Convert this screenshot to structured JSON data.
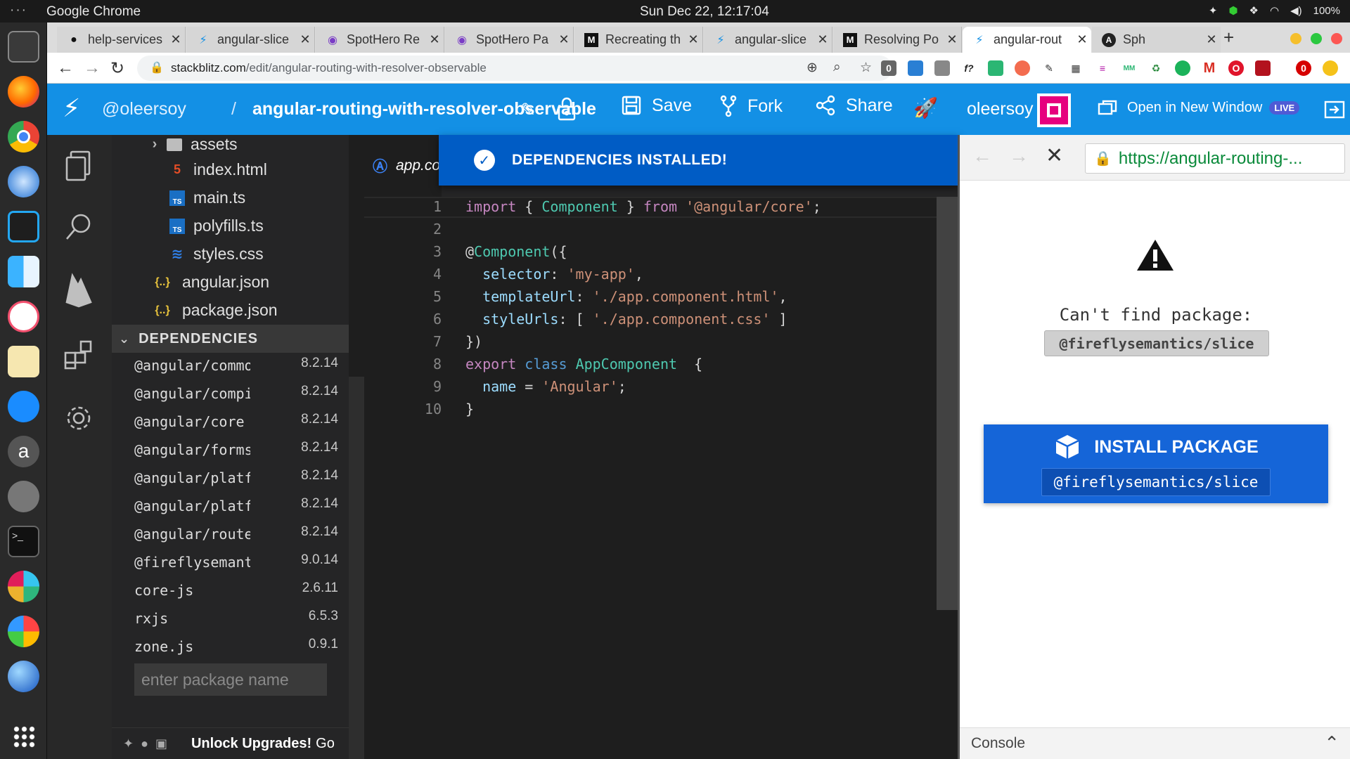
{
  "os": {
    "app_name": "Google Chrome",
    "clock": "Sun Dec 22, 12:17:04",
    "battery": "100%"
  },
  "tabs": [
    {
      "title": "help-services",
      "icon": "github-icon"
    },
    {
      "title": "angular-slice",
      "icon": "stackblitz-icon"
    },
    {
      "title": "SpotHero Re",
      "icon": "spothero-icon"
    },
    {
      "title": "SpotHero Pa",
      "icon": "spothero-icon"
    },
    {
      "title": "Recreating th",
      "icon": "medium-icon"
    },
    {
      "title": "angular-slice",
      "icon": "stackblitz-icon"
    },
    {
      "title": "Resolving Po",
      "icon": "medium-icon"
    },
    {
      "title": "angular-rout",
      "icon": "stackblitz-icon",
      "active": true
    },
    {
      "title": "Sph",
      "icon": "angular-icon"
    }
  ],
  "address": {
    "host": "stackblitz.com",
    "path": "/edit/angular-routing-with-resolver-observable"
  },
  "header": {
    "user": "@oleersoy",
    "separator": "/",
    "project": "angular-routing-with-resolver-observable",
    "save": "Save",
    "fork": "Fork",
    "share": "Share",
    "username": "oleersoy",
    "open_new_window": "Open in New Window",
    "live_badge": "LIVE"
  },
  "files": [
    {
      "name": "assets",
      "icon": "folder-icon"
    },
    {
      "name": "index.html",
      "icon": "html-file-icon"
    },
    {
      "name": "main.ts",
      "icon": "ts-file-icon"
    },
    {
      "name": "polyfills.ts",
      "icon": "ts-file-icon"
    },
    {
      "name": "styles.css",
      "icon": "css-file-icon"
    },
    {
      "name": "angular.json",
      "icon": "json-file-icon"
    },
    {
      "name": "package.json",
      "icon": "json-file-icon"
    }
  ],
  "dependencies": {
    "title": "DEPENDENCIES",
    "items": [
      {
        "name": "@angular/common",
        "version": "8.2.14"
      },
      {
        "name": "@angular/compiler",
        "version": "8.2.14"
      },
      {
        "name": "@angular/core",
        "version": "8.2.14"
      },
      {
        "name": "@angular/forms",
        "version": "8.2.14"
      },
      {
        "name": "@angular/platform-browser",
        "version": "8.2.14"
      },
      {
        "name": "@angular/platform-browser-dynamic",
        "version": "8.2.14"
      },
      {
        "name": "@angular/router",
        "version": "8.2.14"
      },
      {
        "name": "@fireflysemantics/slice",
        "version": "9.0.14"
      },
      {
        "name": "core-js",
        "version": "2.6.11"
      },
      {
        "name": "rxjs",
        "version": "6.5.3"
      },
      {
        "name": "zone.js",
        "version": "0.9.1"
      }
    ],
    "input_placeholder": "enter package name"
  },
  "sidebar_footer": {
    "upgrade": "Unlock Upgrades!",
    "go": "Go"
  },
  "editor": {
    "tab": "app.component.ts",
    "line_numbers": [
      "1",
      "2",
      "3",
      "4",
      "5",
      "6",
      "7",
      "8",
      "9",
      "10"
    ]
  },
  "toast": {
    "message": "DEPENDENCIES INSTALLED!"
  },
  "preview": {
    "url": "https://angular-routing-...",
    "error_title": "Can't find package:",
    "error_package": "@fireflysemantics/slice",
    "install_label": "INSTALL PACKAGE",
    "install_package": "@fireflysemantics/slice",
    "console": "Console"
  },
  "colors": {
    "stackblitz_blue": "#1390e5",
    "toast_blue": "#005cc5",
    "install_blue": "#1565d8"
  }
}
